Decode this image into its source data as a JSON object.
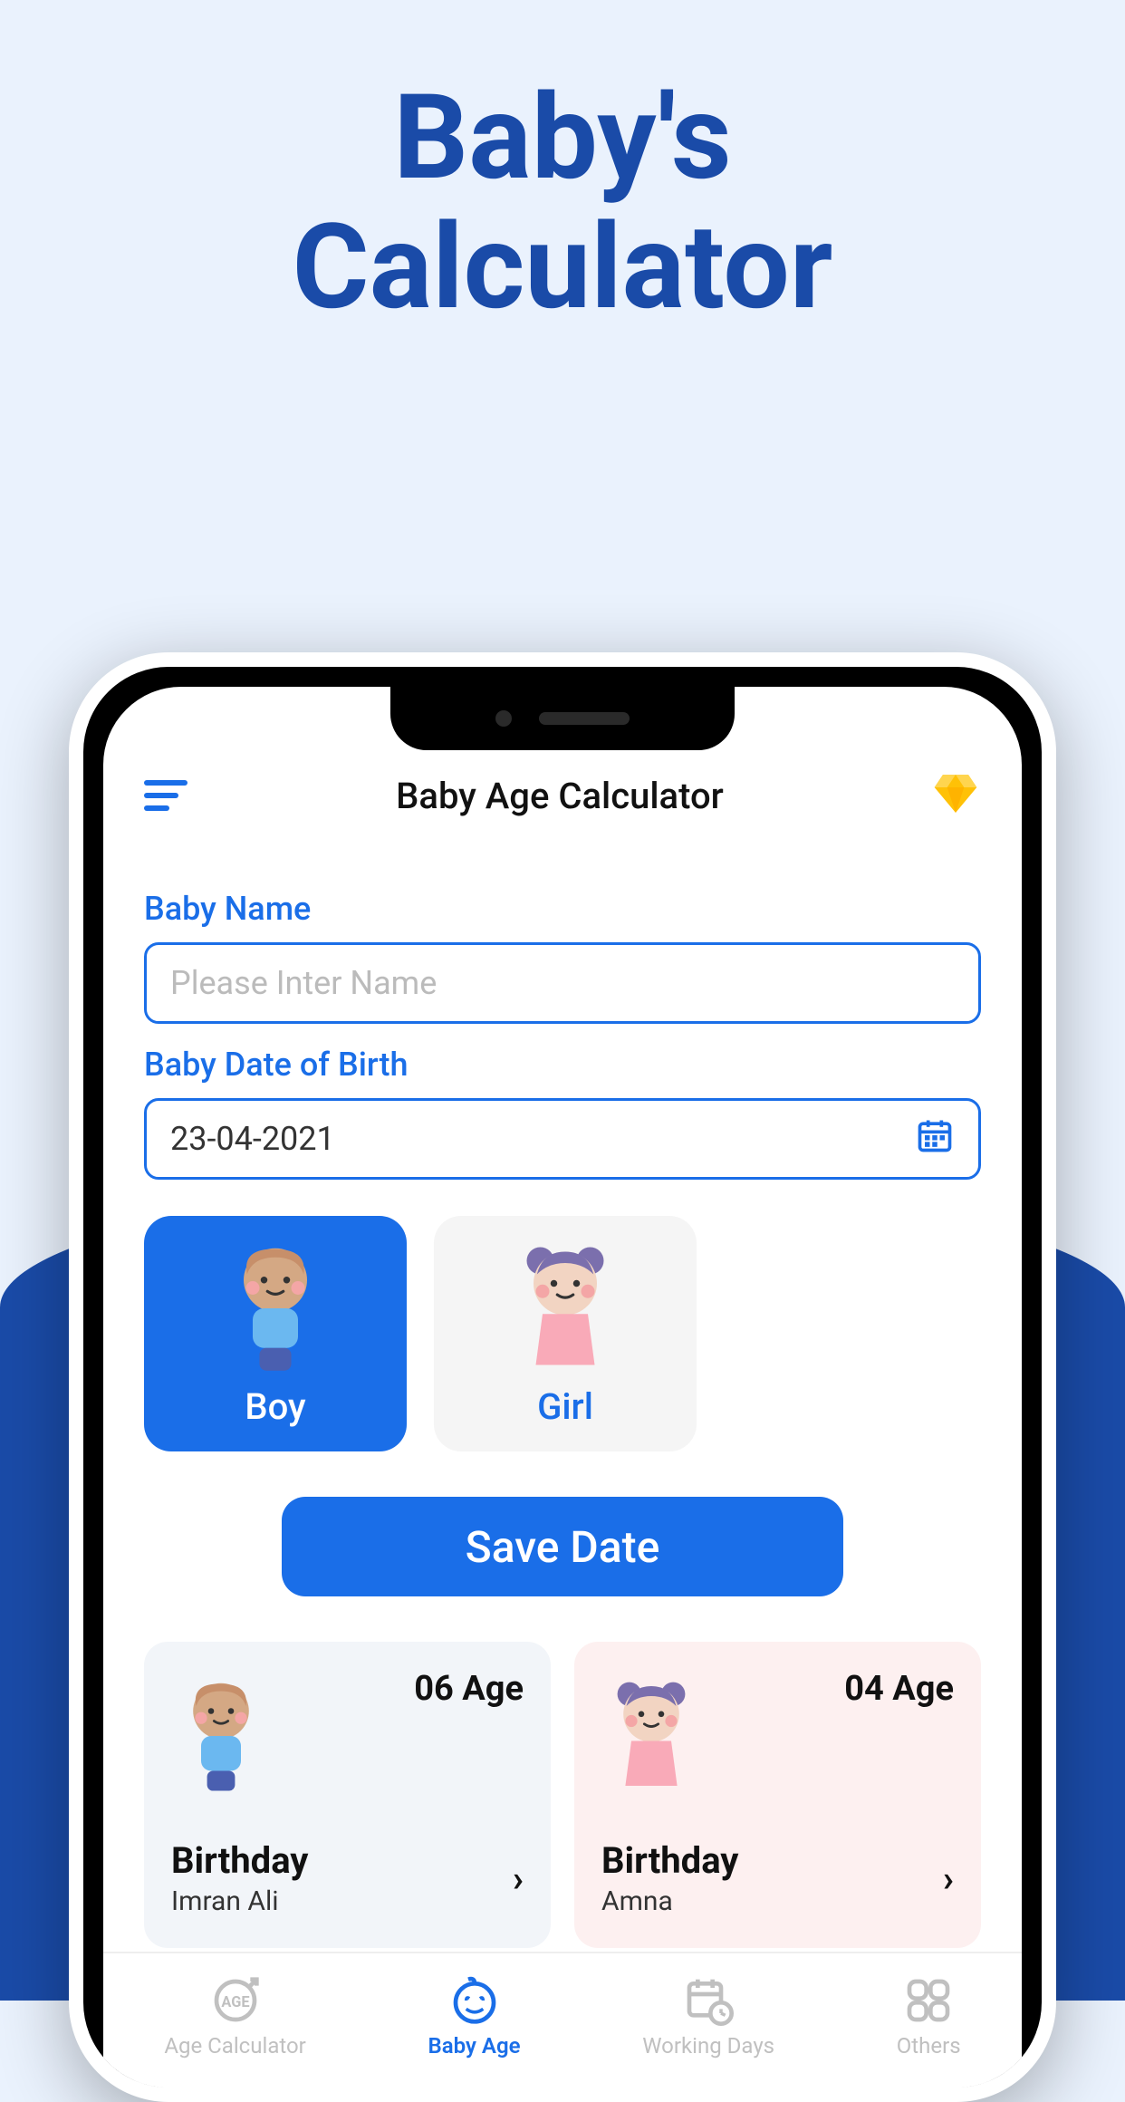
{
  "marketing": {
    "title_line1": "Baby's",
    "title_line2": "Calculator"
  },
  "header": {
    "title": "Baby Age Calculator"
  },
  "form": {
    "name_label": "Baby Name",
    "name_placeholder": "Please Inter Name",
    "dob_label": "Baby Date of Birth",
    "dob_value": "23-04-2021",
    "boy_label": "Boy",
    "girl_label": "Girl",
    "save_label": "Save Date"
  },
  "children": [
    {
      "age_text": "06 Age",
      "birthday_label": "Birthday",
      "name": "Imran Ali"
    },
    {
      "age_text": "04 Age",
      "birthday_label": "Birthday",
      "name": "Amna"
    }
  ],
  "nav": {
    "items": [
      {
        "label": "Age Calculator"
      },
      {
        "label": "Baby Age"
      },
      {
        "label": "Working Days"
      },
      {
        "label": "Others"
      }
    ]
  }
}
